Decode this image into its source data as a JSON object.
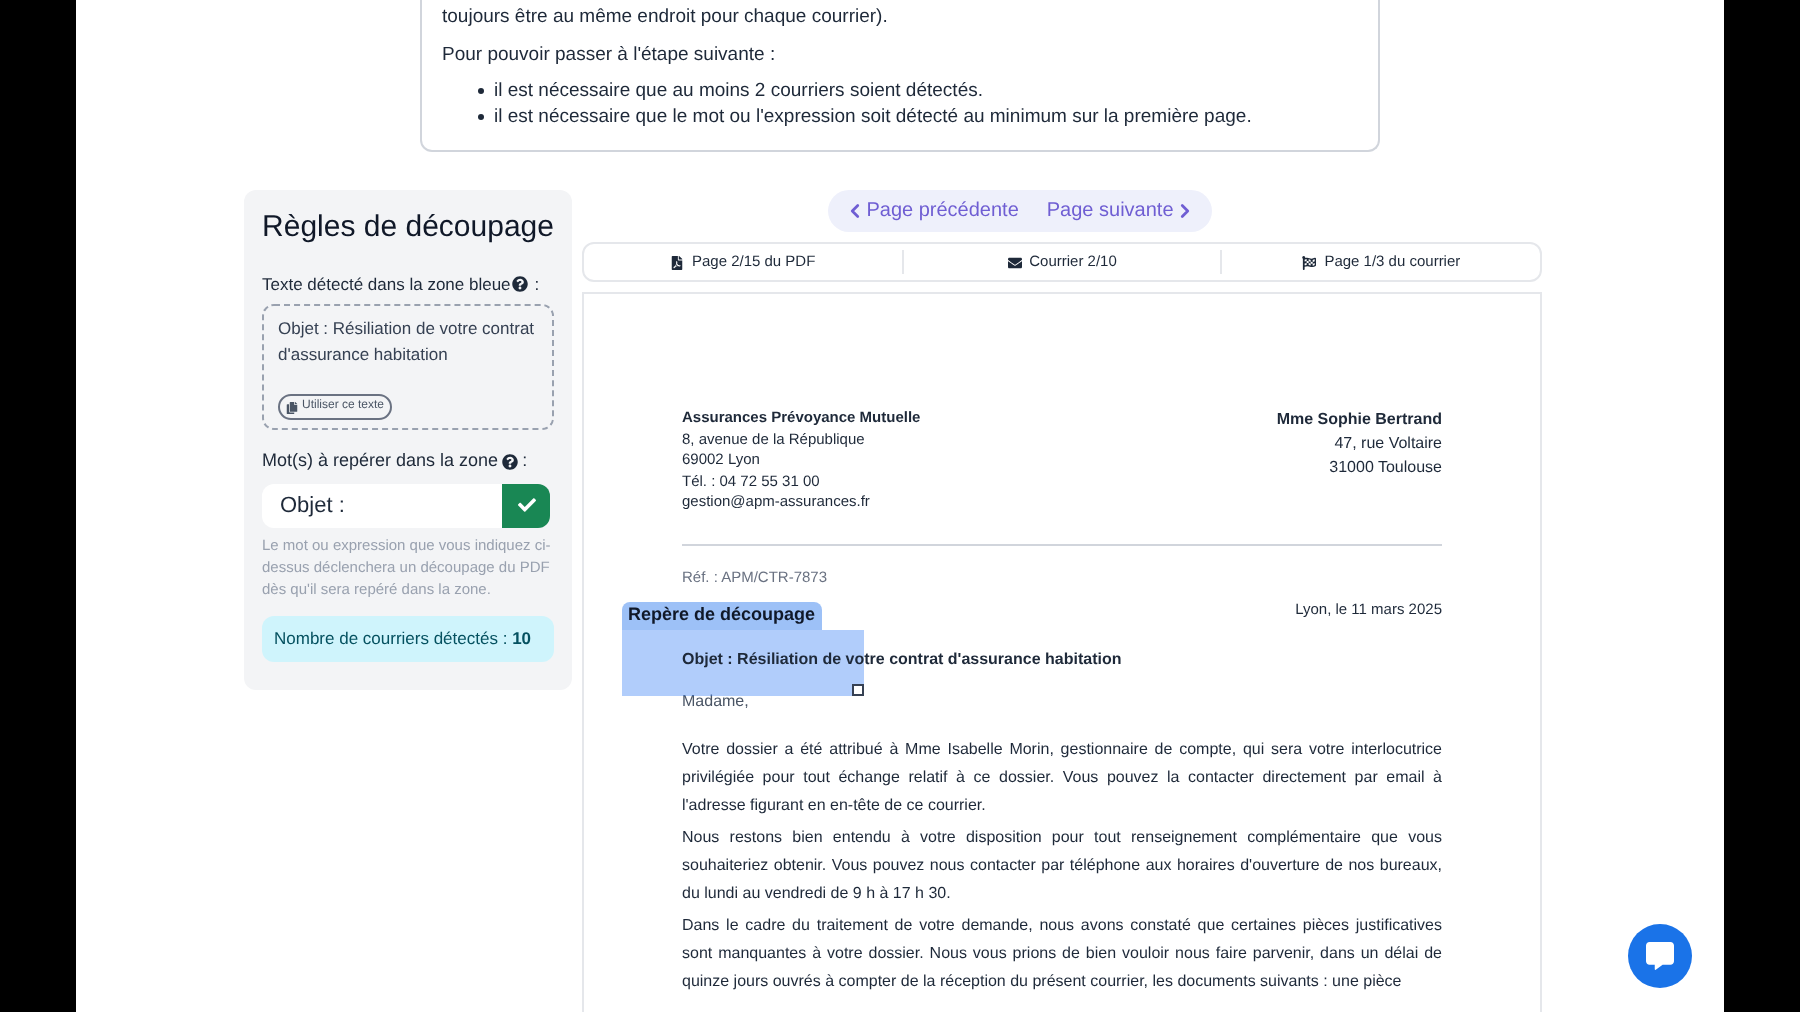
{
  "instructions": {
    "text_lines": [
      "toujours être au même endroit pour chaque courrier)."
    ],
    "heading": "Pour pouvoir passer à l'étape suivante :",
    "bullets": [
      "il est nécessaire que au moins 2 courriers soient détectés.",
      "il est nécessaire que le mot ou l'expression soit détecté au minimum sur la première page."
    ]
  },
  "rules_panel": {
    "title": "Règles de découpage",
    "detected_label": "Texte détecté dans la zone bleue",
    "detected_label_suffix": ":",
    "detected_text": "Objet : Résiliation de votre contrat d'assurance habitation",
    "use_text_button": "Utiliser ce texte",
    "keyword_label": "Mot(s) à repérer dans la zone",
    "keyword_label_suffix": ":",
    "keyword_value": "Objet :",
    "help_text": "Le mot ou expression que vous indiquez ci-dessus déclenchera un découpage du PDF dès qu'il sera repéré dans la zone.",
    "count_label": "Nombre de courriers détectés : ",
    "count_value": "10"
  },
  "nav": {
    "previous": "Page précédente",
    "next": "Page suivante"
  },
  "info_bar": [
    {
      "kind": "pdf",
      "text": "Page 2/15 du PDF"
    },
    {
      "kind": "letter",
      "text": "Courrier 2/10"
    },
    {
      "kind": "flag",
      "text": "Page 1/3 du courrier"
    }
  ],
  "document": {
    "sender": [
      "Assurances Prévoyance Mutuelle",
      "8, avenue de la République",
      "69002 Lyon",
      "Tél. : 04 72 55 31 00",
      "gestion@apm-assurances.fr"
    ],
    "recipient": [
      "Mme Sophie Bertrand",
      "47, rue Voltaire",
      "31000 Toulouse"
    ],
    "reference": "Réf. : APM/CTR-7873",
    "date": "Lyon, le 11 mars 2025",
    "selection_label": "Repère de découpage",
    "subject": "Objet : Résiliation de votre contrat d'assurance habitation",
    "salutation": "Madame,",
    "paragraphs": [
      "Votre dossier a été attribué à Mme Isabelle Morin, gestionnaire de compte, qui sera votre interlocutrice privilégiée pour tout échange relatif à ce dossier. Vous pouvez la contacter directement par email à l'adresse figurant en en-tête de ce courrier.",
      "Nous restons bien entendu à votre disposition pour tout renseignement complémentaire que vous souhaiteriez obtenir. Vous pouvez nous contacter par téléphone aux horaires d'ouverture de nos bureaux, du lundi au vendredi de 9 h à 17 h 30.",
      "Dans le cadre du traitement de votre demande, nous avons constaté que certaines pièces justificatives sont manquantes à votre dossier. Nous vous prions de bien vouloir nous faire parvenir, dans un délai de quinze jours ouvrés à compter de la réception du présent courrier, les documents suivants : une pièce"
    ]
  }
}
